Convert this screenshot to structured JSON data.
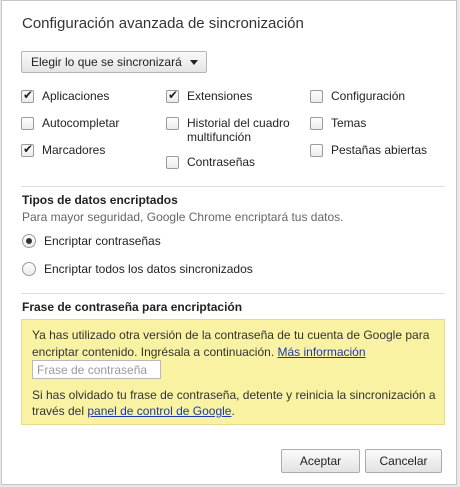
{
  "dialog": {
    "title": "Configuración avanzada de sincronización"
  },
  "sync": {
    "dropdown_label": "Elegir lo que se sincronizará",
    "items": [
      {
        "label": "Aplicaciones",
        "checked": true
      },
      {
        "label": "Autocompletar",
        "checked": false
      },
      {
        "label": "Marcadores",
        "checked": true
      },
      {
        "label": "Extensiones",
        "checked": true
      },
      {
        "label": "Historial del cuadro multifunción",
        "checked": false
      },
      {
        "label": "Contraseñas",
        "checked": false
      },
      {
        "label": "Configuración",
        "checked": false
      },
      {
        "label": "Temas",
        "checked": false
      },
      {
        "label": "Pestañas abiertas",
        "checked": false
      }
    ]
  },
  "encryption": {
    "title": "Tipos de datos encriptados",
    "description": "Para mayor seguridad, Google Chrome encriptará tus datos.",
    "options": [
      {
        "label": "Encriptar contraseñas",
        "selected": true
      },
      {
        "label": "Encriptar todos los datos sincronizados",
        "selected": false
      }
    ]
  },
  "passphrase": {
    "title": "Frase de contraseña para encriptación",
    "notice_text": "Ya has utilizado otra versión de la contraseña de tu cuenta de Google para encriptar contenido. Ingrésala a continuación.",
    "more_info_link": "Más información",
    "input_placeholder": "Frase de contraseña",
    "input_value": "",
    "forgot_text": "Si has olvidado tu frase de contraseña, detente y reinicia la sincronización a través del",
    "dashboard_link": "panel de control de Google",
    "forgot_end": "."
  },
  "buttons": {
    "accept": "Aceptar",
    "cancel": "Cancelar"
  }
}
